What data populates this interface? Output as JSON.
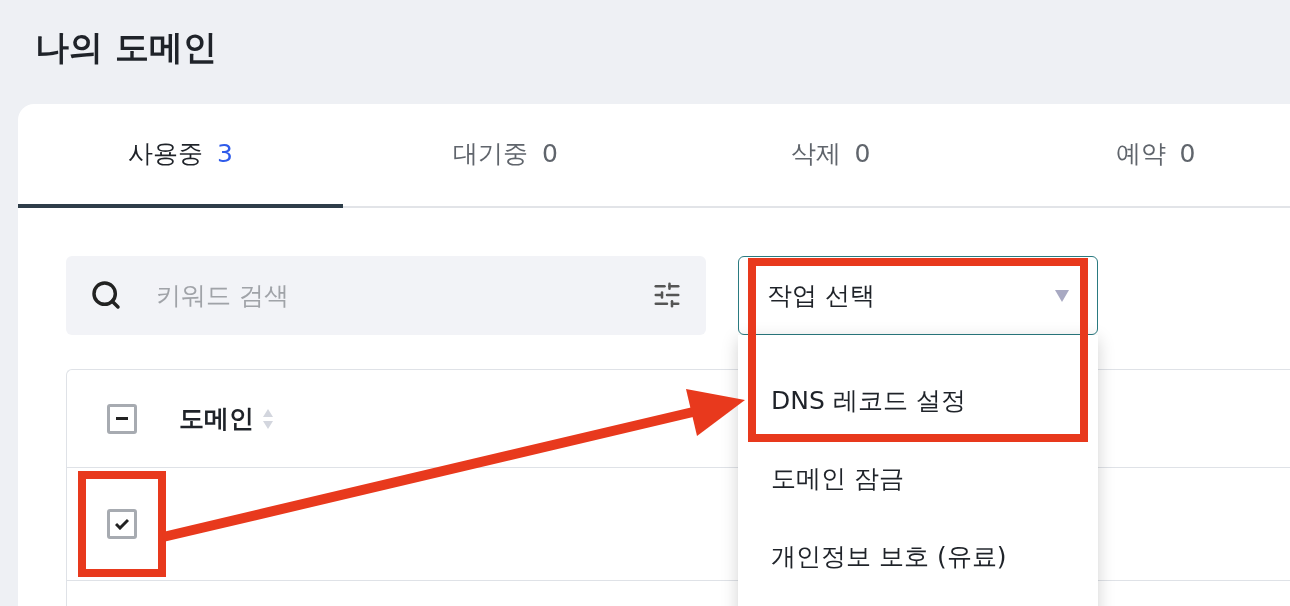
{
  "page_title": "나의 도메인",
  "tabs": [
    {
      "label": "사용중",
      "count": "3",
      "selected": true
    },
    {
      "label": "대기중",
      "count": "0",
      "selected": false
    },
    {
      "label": "삭제",
      "count": "0",
      "selected": false
    },
    {
      "label": "예약",
      "count": "0",
      "selected": false
    }
  ],
  "search": {
    "placeholder": "키워드 검색"
  },
  "action_select": {
    "value": "작업 선택",
    "expanded": true,
    "options": [
      "DNS 레코드 설정",
      "도메인 잠금",
      "개인정보 보호 (유료)"
    ]
  },
  "table": {
    "columns": [
      {
        "label": "도메인",
        "sortable": true
      }
    ],
    "header_checkbox": {
      "indeterminate": true
    },
    "rows": [
      {
        "checked": true
      }
    ]
  }
}
